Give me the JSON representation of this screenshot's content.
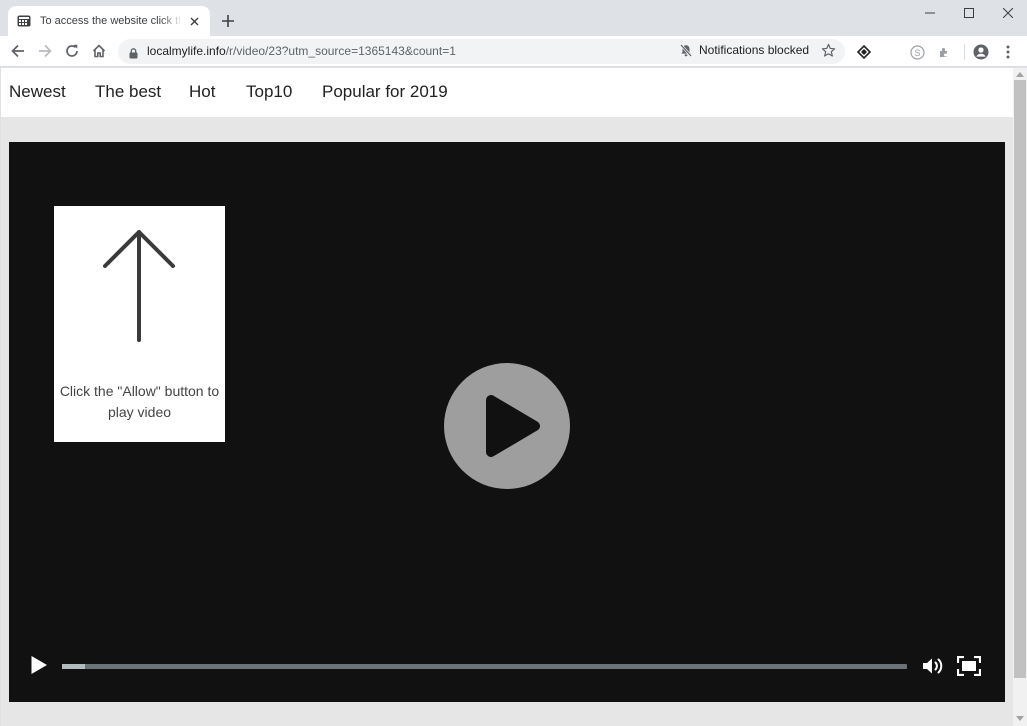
{
  "browser": {
    "tab_title": "To access the website click the \"Allow\" button",
    "url_host": "localmylife.info",
    "url_path": "/r/video/23?utm_source=1365143&count=1",
    "notifications_status": "Notifications blocked",
    "icons": {
      "back": "arrow-left-icon",
      "forward": "arrow-right-icon",
      "reload": "reload-icon",
      "home": "home-icon",
      "lock": "lock-icon",
      "star": "star-icon",
      "profile": "account-circle-icon",
      "menu": "three-dots-icon"
    }
  },
  "site_nav": {
    "items": [
      {
        "label": "Newest"
      },
      {
        "label": "The best"
      },
      {
        "label": "Hot"
      },
      {
        "label": "Top10"
      },
      {
        "label": "Popular for 2019"
      }
    ]
  },
  "overlay": {
    "message": "Click the \"Allow\" button to play video"
  },
  "player": {
    "progress_fraction": 0.027,
    "colors": {
      "background": "#111111",
      "big_play": "#9e9e9e",
      "track": "#6b7378",
      "fill": "#b4bbbf"
    }
  }
}
